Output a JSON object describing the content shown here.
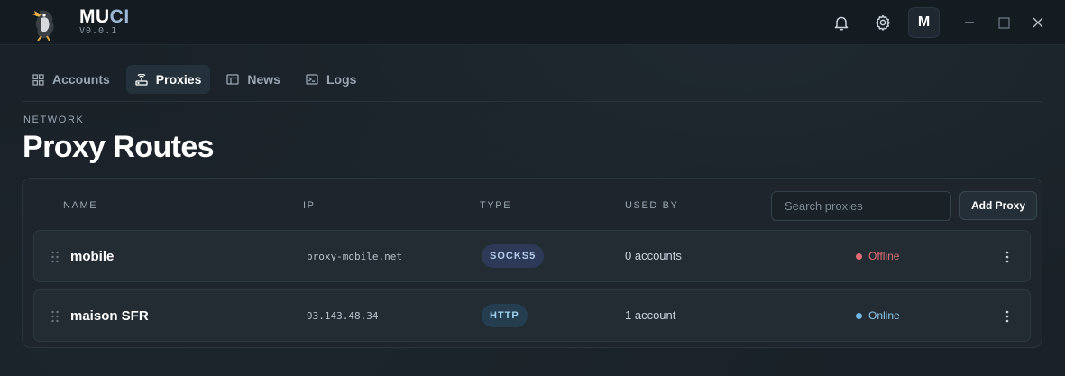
{
  "app": {
    "name_main": "MU",
    "name_accent": "CI",
    "version": "V0.0.1",
    "avatar_letter": "M"
  },
  "nav": {
    "tabs": [
      {
        "label": "Accounts",
        "icon": "grid-icon",
        "active": false
      },
      {
        "label": "Proxies",
        "icon": "router-icon",
        "active": true
      },
      {
        "label": "News",
        "icon": "newspaper-icon",
        "active": false
      },
      {
        "label": "Logs",
        "icon": "terminal-icon",
        "active": false
      }
    ]
  },
  "page": {
    "eyebrow": "NETWORK",
    "title": "Proxy Routes"
  },
  "table": {
    "columns": {
      "name": "NAME",
      "ip": "IP",
      "type": "TYPE",
      "used_by": "USED BY"
    },
    "search_placeholder": "Search proxies",
    "add_label": "Add Proxy",
    "rows": [
      {
        "name": "mobile",
        "ip": "proxy-mobile.net",
        "type": "SOCKS5",
        "used_by": "0 accounts",
        "status": "Offline"
      },
      {
        "name": "maison SFR",
        "ip": "93.143.48.34",
        "type": "HTTP",
        "used_by": "1 account",
        "status": "Online"
      }
    ]
  },
  "colors": {
    "offline": "#e06c75",
    "online": "#6fb7e6"
  }
}
